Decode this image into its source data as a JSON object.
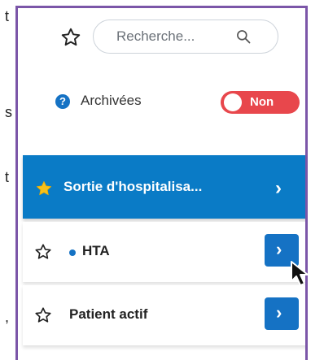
{
  "background_fragments": [
    "t",
    "s",
    "t",
    ","
  ],
  "search": {
    "placeholder": "Recherche..."
  },
  "archived": {
    "label": "Archivées",
    "toggle_state": "Non",
    "toggle_color": "#e8474c"
  },
  "favorite_group": {
    "label": "Sortie d'hospitalisa...",
    "accent": "#0a7bc6"
  },
  "items": [
    {
      "label": "HTA",
      "has_dot": true
    },
    {
      "label": "Patient actif",
      "has_dot": false
    }
  ],
  "icons": {
    "favorite_toggle": "star-outline-icon",
    "search": "search-icon",
    "help": "question-circle-icon",
    "group_star": "star-filled-icon",
    "chevron": "chevron-right-icon",
    "cursor": "mouse-pointer-icon"
  }
}
